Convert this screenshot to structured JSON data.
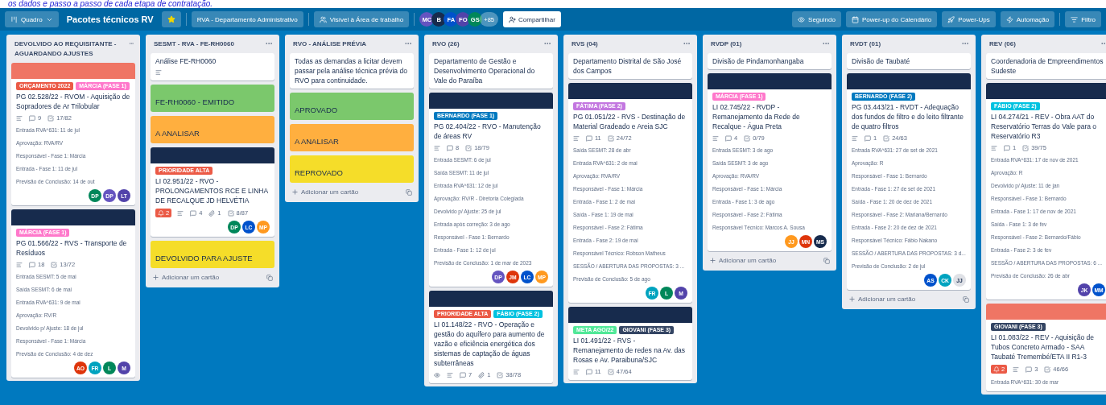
{
  "caption": "os dados e passo a passo de cada etapa de contratação.",
  "header": {
    "board_switcher": "Quadro",
    "title": "Pacotes técnicos RV",
    "starred": true,
    "workspace": "RVA - Departamento Administrativo",
    "visibility": "Visível à Área de trabalho",
    "members": [
      {
        "initials": "MC",
        "color": "#6554c0"
      },
      {
        "initials": "B",
        "color": "#172b4d"
      },
      {
        "initials": "FA",
        "color": "#0052cc"
      },
      {
        "initials": "FO",
        "color": "#5243aa"
      },
      {
        "initials": "GS",
        "color": "#00875a"
      }
    ],
    "more_members": "+85",
    "share": "Compartilhar",
    "actions": [
      {
        "kind": "watch",
        "label": "Seguindo"
      },
      {
        "kind": "calendar",
        "label": "Power-up do Calendário"
      },
      {
        "kind": "powerups",
        "label": "Power-Ups"
      },
      {
        "kind": "automation",
        "label": "Automação"
      },
      {
        "kind": "filter",
        "label": "Filtro"
      }
    ]
  },
  "lists": [
    {
      "title": "DEVOLVIDO AO REQUISITANTE - AGUARDANDO AJUSTES",
      "cards": [
        {
          "kind": "task",
          "cover": {
            "color": "#ef7564"
          },
          "labels": [
            {
              "text": "ORÇAMENTO 2022",
              "color": "#eb5a46"
            },
            {
              "text": "MÁRCIA (FASE 1)",
              "color": "#ff78cb"
            }
          ],
          "title": "PG 02.528/22 - RVOM - Aquisição de Sopradores de Ar Trilobular",
          "badges": [
            {
              "kind": "description"
            },
            {
              "kind": "comments",
              "value": "9"
            },
            {
              "kind": "checklist",
              "value": "17/82"
            }
          ],
          "fields": [
            "Entrada RVA^631: 11 de jul",
            "Aprovação: RVA/RV",
            "Responsável - Fase 1: Márcia",
            "Entrada - Fase 1: 11 de jul",
            "Previsão de Conclusão: 14 de out"
          ],
          "members": [
            {
              "initials": "DP",
              "color": "#00875a"
            },
            {
              "initials": "DP",
              "color": "#6554c0"
            },
            {
              "initials": "LT",
              "color": "#5243aa"
            }
          ]
        },
        {
          "kind": "task",
          "cover": {
            "color": "#172b4d"
          },
          "labels": [
            {
              "text": "MÁRCIA (FASE 1)",
              "color": "#ff78cb"
            }
          ],
          "title": "PG 01.566/22 - RVS - Transporte de Resíduos",
          "badges": [
            {
              "kind": "description"
            },
            {
              "kind": "comments",
              "value": "18"
            },
            {
              "kind": "checklist",
              "value": "13/72"
            }
          ],
          "fields": [
            "Entrada SESMT: 5 de mai",
            "Saída SESMT: 6 de mai",
            "Entrada RVA^631: 9 de mai",
            "Aprovação: RV/R",
            "Devolvido p/ Ajuste: 18 de jul",
            "Responsável - Fase 1: Márcia",
            "Previsão de Conclusão: 4 de dez"
          ],
          "members": [
            {
              "initials": "AO",
              "color": "#de350b"
            },
            {
              "initials": "FR",
              "color": "#00a3bf"
            },
            {
              "initials": "L",
              "color": "#00875a"
            },
            {
              "initials": "M",
              "color": "#5243aa"
            }
          ]
        }
      ]
    },
    {
      "title": "SESMT - RVA - FE-RH0060",
      "add_card": "Adicionar um cartão",
      "cards": [
        {
          "kind": "text",
          "title": "Análise FE-RH0060",
          "badges": [
            {
              "kind": "description"
            }
          ]
        },
        {
          "kind": "color",
          "title": "FE-RH0060 - EMITIDO",
          "color": "#7bc86c"
        },
        {
          "kind": "color",
          "title": "A ANALISAR",
          "color": "#ffaf3f"
        },
        {
          "kind": "task",
          "cover": {
            "color": "#172b4d"
          },
          "labels": [
            {
              "text": "PRIORIDADE ALTA",
              "color": "#eb5a46"
            }
          ],
          "title": "LI 02.951/22 - RVO - PROLONGAMENTOS RCE E LINHA DE RECALQUE JD HELVÉTIA",
          "badges": [
            {
              "kind": "notification",
              "value": "2"
            },
            {
              "kind": "description"
            },
            {
              "kind": "comments",
              "value": "4"
            },
            {
              "kind": "attachments",
              "value": "1"
            },
            {
              "kind": "checklist",
              "value": "8/87"
            }
          ],
          "members": [
            {
              "initials": "DP",
              "color": "#00875a"
            },
            {
              "initials": "LC",
              "color": "#0052cc"
            },
            {
              "initials": "MP",
              "color": "#ff991f"
            }
          ]
        },
        {
          "kind": "color",
          "title": "DEVOLVIDO PARA AJUSTE",
          "color": "#f5dd29"
        }
      ]
    },
    {
      "title": "RVO - ANÁLISE PRÉVIA",
      "add_card": "Adicionar um cartão",
      "cards": [
        {
          "kind": "text",
          "title": "Todas as demandas a licitar devem passar pela análise técnica prévia do RVO para continuidade."
        },
        {
          "kind": "color",
          "title": "APROVADO",
          "color": "#7bc86c"
        },
        {
          "kind": "color",
          "title": "A ANALISAR",
          "color": "#ffaf3f"
        },
        {
          "kind": "color",
          "title": "REPROVADO",
          "color": "#f5dd29"
        }
      ]
    },
    {
      "title": "RVO (26)",
      "cards": [
        {
          "kind": "text",
          "title": "Departamento de Gestão e Desenvolvimento Operacional do Vale do Paraíba"
        },
        {
          "kind": "task",
          "cover": {
            "color": "#172b4d"
          },
          "labels": [
            {
              "text": "BERNARDO (FASE 1)",
              "color": "#0079bf"
            }
          ],
          "title": "PG 02.404/22 - RVO - Manutenção de áreas RV",
          "badges": [
            {
              "kind": "description"
            },
            {
              "kind": "comments",
              "value": "8"
            },
            {
              "kind": "checklist",
              "value": "18/79"
            }
          ],
          "fields": [
            "Entrada SESMT: 6 de jul",
            "Saída SESMT: 11 de jul",
            "Entrada RVA^631: 12 de jul",
            "Aprovação: RV/R - Diretoria Colegiada",
            "Devolvido p/ Ajuste: 25 de jul",
            "Entrada após correção: 3 de ago",
            "Responsável - Fase 1: Bernardo",
            "Entrada - Fase 1: 12 de jul",
            "Previsão de Conclusão: 1 de mar de 2023"
          ],
          "members": [
            {
              "initials": "DP",
              "color": "#6554c0"
            },
            {
              "initials": "JM",
              "color": "#de350b"
            },
            {
              "initials": "LC",
              "color": "#0052cc"
            },
            {
              "initials": "MP",
              "color": "#ff991f"
            }
          ]
        },
        {
          "kind": "task",
          "cover": {
            "color": "#172b4d"
          },
          "labels": [
            {
              "text": "PRIORIDADE ALTA",
              "color": "#eb5a46"
            },
            {
              "text": "FÁBIO (FASE 2)",
              "color": "#00c2e0"
            }
          ],
          "title": "LI 01.148/22 - RVO - Operação e gestão do aquífero para aumento de vazão e eficiência energética dos sistemas de captação de águas subterrâneas",
          "badges": [
            {
              "kind": "watch"
            },
            {
              "kind": "description"
            },
            {
              "kind": "comments",
              "value": "7"
            },
            {
              "kind": "attachments",
              "value": "1"
            },
            {
              "kind": "checklist",
              "value": "38/78"
            }
          ]
        }
      ]
    },
    {
      "title": "RVS (04)",
      "cards": [
        {
          "kind": "text",
          "title": "Departamento Distrital de São José dos Campos"
        },
        {
          "kind": "task",
          "cover": {
            "color": "#172b4d"
          },
          "labels": [
            {
              "text": "FÁTIMA (FASE 2)",
              "color": "#c377e0"
            }
          ],
          "title": "PG 01.051/22 - RVS - Destinação de Material Gradeado e Areia SJC",
          "badges": [
            {
              "kind": "description"
            },
            {
              "kind": "comments",
              "value": "11"
            },
            {
              "kind": "checklist",
              "value": "24/72"
            }
          ],
          "fields": [
            "Saída SESMT: 28 de abr",
            "Entrada RVA^631: 2 de mai",
            "Aprovação: RVA/RV",
            "Responsável - Fase 1: Márcia",
            "Entrada - Fase 1: 2 de mai",
            "Saída - Fase 1: 19 de mai",
            "Responsável - Fase 2: Fátima",
            "Entrada - Fase 2: 19 de mai",
            "Responsável Técnico: Robson Matheus",
            "SESSÃO / ABERTURA DAS PROPOSTAS: 3 ...",
            "Previsão de Conclusão: 5 de ago"
          ],
          "members": [
            {
              "initials": "FR",
              "color": "#00a3bf"
            },
            {
              "initials": "L",
              "color": "#00875a"
            },
            {
              "initials": "M",
              "color": "#5243aa"
            }
          ]
        },
        {
          "kind": "task",
          "cover": {
            "color": "#172b4d"
          },
          "labels": [
            {
              "text": "META AGO/22",
              "color": "#51e898"
            },
            {
              "text": "GIOVANI (FASE 3)",
              "color": "#344563"
            }
          ],
          "title": "LI 01.491/22 - RVS - Remanejamento de redes na Av. das Rosas e Av. Paraibuna/SJC",
          "badges": [
            {
              "kind": "description"
            },
            {
              "kind": "comments",
              "value": "11"
            },
            {
              "kind": "checklist",
              "value": "47/64"
            }
          ]
        }
      ]
    },
    {
      "title": "RVDP (01)",
      "add_card": "Adicionar um cartão",
      "cards": [
        {
          "kind": "text",
          "title": "Divisão de Pindamonhangaba"
        },
        {
          "kind": "task",
          "cover": {
            "color": "#172b4d"
          },
          "labels": [
            {
              "text": "MÁRCIA (FASE 1)",
              "color": "#ff78cb"
            }
          ],
          "title": "LI 02.745/22 - RVDP - Remanejamento da Rede de Recalque - Água Preta",
          "badges": [
            {
              "kind": "description"
            },
            {
              "kind": "comments",
              "value": "4"
            },
            {
              "kind": "checklist",
              "value": "0/79"
            }
          ],
          "fields": [
            "Entrada SESMT: 3 de ago",
            "Saída SESMT: 3 de ago",
            "Aprovação: RVA/RV",
            "Responsável - Fase 1: Márcia",
            "Entrada - Fase 1: 3 de ago",
            "Responsável - Fase 2: Fátima",
            "Responsável Técnico: Marcos A. Sousa"
          ],
          "members": [
            {
              "initials": "JJ",
              "color": "#ff991f"
            },
            {
              "initials": "MN",
              "color": "#de350b"
            },
            {
              "initials": "MS",
              "color": "#172b4d"
            }
          ]
        }
      ]
    },
    {
      "title": "RVDT (01)",
      "add_card": "Adicionar um cartão",
      "cards": [
        {
          "kind": "text",
          "title": "Divisão de Taubaté"
        },
        {
          "kind": "task",
          "cover": {
            "color": "#172b4d"
          },
          "labels": [
            {
              "text": "BERNARDO (FASE 2)",
              "color": "#0079bf"
            }
          ],
          "title": "PG 03.443/21 - RVDT - Adequação dos fundos de filtro e do leito filtrante de quatro filtros",
          "badges": [
            {
              "kind": "description"
            },
            {
              "kind": "comments",
              "value": "1"
            },
            {
              "kind": "checklist",
              "value": "24/63"
            }
          ],
          "fields": [
            "Entrada RVA^631: 27 de set de 2021",
            "Aprovação: R",
            "Responsável - Fase 1: Bernardo",
            "Entrada - Fase 1: 27 de set de 2021",
            "Saída - Fase 1: 20 de dez de 2021",
            "Responsável - Fase 2: Mariana/Bernardo",
            "Entrada - Fase 2: 20 de dez de 2021",
            "Responsável Técnico: Fábio Nakano",
            "SESSÃO / ABERTURA DAS PROPOSTAS: 3 d...",
            "Previsão de Conclusão: 2 de jul"
          ],
          "members": [
            {
              "initials": "AS",
              "color": "#0052cc"
            },
            {
              "initials": "CK",
              "color": "#00a3bf"
            },
            {
              "initials": "JJ",
              "color": "#dfe1e6"
            }
          ]
        }
      ]
    },
    {
      "title": "REV (06)",
      "cards": [
        {
          "kind": "text",
          "title": "Coordenadoria de Empreendimentos Sudeste"
        },
        {
          "kind": "task",
          "cover": {
            "color": "#172b4d"
          },
          "labels": [
            {
              "text": "FÁBIO (FASE 2)",
              "color": "#00c2e0"
            }
          ],
          "title": "LI 04.274/21 - REV - Obra AAT do Reservatório Terras do Vale para o Reservatório R3",
          "badges": [
            {
              "kind": "description"
            },
            {
              "kind": "comments",
              "value": "1"
            },
            {
              "kind": "checklist",
              "value": "39/75"
            }
          ],
          "fields": [
            "Entrada RVA^631: 17 de nov de 2021",
            "Aprovação: R",
            "Devolvido p/ Ajuste: 11 de jan",
            "Responsável - Fase 1: Bernardo",
            "Entrada - Fase 1: 17 de nov de 2021",
            "Saída - Fase 1: 3 de fev",
            "Responsável - Fase 2: Bernardo/Fábio",
            "Entrada - Fase 2: 3 de fev",
            "SESSÃO / ABERTURA DAS PROPOSTAS: 6 ...",
            "Previsão de Conclusão: 26 de abr"
          ],
          "members": [
            {
              "initials": "JK",
              "color": "#5243aa"
            },
            {
              "initials": "MM",
              "color": "#0052cc"
            }
          ]
        },
        {
          "kind": "task",
          "cover": {
            "color": "#ef7564"
          },
          "labels": [
            {
              "text": "GIOVANI (FASE 3)",
              "color": "#344563"
            }
          ],
          "title": "LI 01.083/22 - REV - Aquisição de Tubos Concreto Armado - SAA Taubaté Tremembé/ETA II R1-3",
          "badges": [
            {
              "kind": "notification",
              "value": "2"
            },
            {
              "kind": "description"
            },
            {
              "kind": "comments",
              "value": "3"
            },
            {
              "kind": "checklist",
              "value": "46/66"
            }
          ],
          "fields": [
            "Entrada RVA^631: 30 de mar"
          ]
        }
      ]
    }
  ]
}
